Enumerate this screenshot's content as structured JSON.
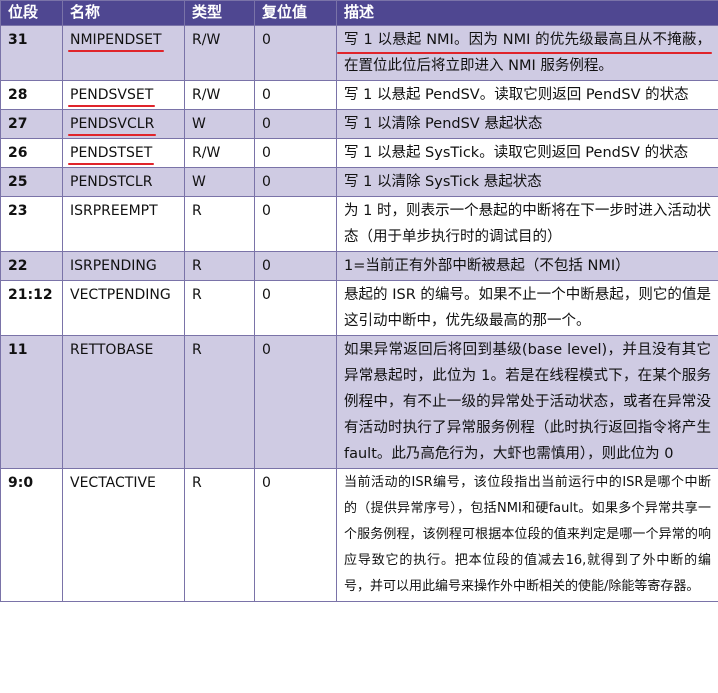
{
  "headers": [
    "位段",
    "名称",
    "类型",
    "复位值",
    "描述"
  ],
  "rows": [
    {
      "bit": "31",
      "name": "NMIPENDSET",
      "type": "R/W",
      "reset": "0",
      "desc": "写 1 以悬起 NMI。因为 NMI 的优先级最高且从不掩蔽，在置位此位后将立即进入 NMI 服务例程。",
      "underline": true,
      "shade": true
    },
    {
      "bit": "28",
      "name": "PENDSVSET",
      "type": "R/W",
      "reset": "0",
      "desc": "写 1 以悬起 PendSV。读取它则返回 PendSV 的状态",
      "underline": true,
      "shade": false
    },
    {
      "bit": "27",
      "name": "PENDSVCLR",
      "type": "W",
      "reset": "0",
      "desc": "写 1 以清除 PendSV 悬起状态",
      "underline": true,
      "shade": true
    },
    {
      "bit": "26",
      "name": "PENDSTSET",
      "type": "R/W",
      "reset": "0",
      "desc": "写 1 以悬起 SysTick。读取它则返回 PendSV 的状态",
      "underline": true,
      "shade": false
    },
    {
      "bit": "25",
      "name": "PENDSTCLR",
      "type": "W",
      "reset": "0",
      "desc": "写 1 以清除 SysTick 悬起状态",
      "underline": false,
      "shade": true
    },
    {
      "bit": "23",
      "name": "ISRPREEMPT",
      "type": "R",
      "reset": "0",
      "desc": "为 1 时，则表示一个悬起的中断将在下一步时进入活动状态（用于单步执行时的调试目的）",
      "underline": false,
      "shade": false
    },
    {
      "bit": "22",
      "name": "ISRPENDING",
      "type": "R",
      "reset": "0",
      "desc": "1=当前正有外部中断被悬起（不包括 NMI）",
      "underline": false,
      "shade": true
    },
    {
      "bit": "21:12",
      "name": "VECTPENDING",
      "type": "R",
      "reset": "0",
      "desc": "悬起的 ISR 的编号。如果不止一个中断悬起，则它的值是这引动中断中，优先级最高的那一个。",
      "underline": false,
      "shade": false
    },
    {
      "bit": "11",
      "name": "RETTOBASE",
      "type": "R",
      "reset": "0",
      "desc": "如果异常返回后将回到基级(base level)，并且没有其它异常悬起时，此位为 1。若是在线程模式下，在某个服务例程中，有不止一级的异常处于活动状态，或者在异常没有活动时执行了异常服务例程（此时执行返回指令将产生 fault。此乃高危行为，大虾也需慎用），则此位为 0",
      "underline": false,
      "shade": true
    },
    {
      "bit": "9:0",
      "name": "VECTACTIVE",
      "type": "R",
      "reset": "0",
      "desc": "当前活动的ISR编号，该位段指出当前运行中的ISR是哪个中断的（提供异常序号），包括NMI和硬fault。如果多个异常共享一个服务例程，该例程可根据本位段的值来判定是哪一个异常的响应导致它的执行。把本位段的值减去16,就得到了外中断的编号，并可以用此编号来操作外中断相关的使能/除能等寄存器。",
      "underline": false,
      "shade": false
    }
  ],
  "colors": {
    "header_bg": "#4f4791",
    "shade_bg": "#cfcbe3",
    "annotation": "#e0242b"
  }
}
